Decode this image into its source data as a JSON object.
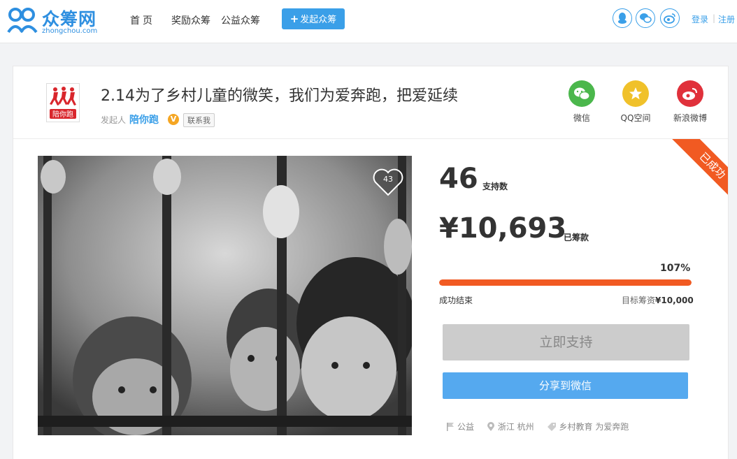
{
  "nav": {
    "logo_text": "众筹网",
    "logo_sub": "zhongchou.com",
    "home": "首页",
    "reward": "奖励众筹",
    "charity": "公益众筹",
    "launch": "发起众筹",
    "login": "登录",
    "separator": "|",
    "register": "注册",
    "icons": [
      "qq-icon",
      "wechat-icon",
      "weibo-icon"
    ]
  },
  "project": {
    "title": "2.14为了乡村儿童的微笑，我们为爱奔跑，把爱延续",
    "initiator_label": "发起人",
    "initiator_name": "陪你跑",
    "verified_badge": "V",
    "contact": "联系我",
    "logo_text": "陪你跑"
  },
  "share": {
    "wechat": "微信",
    "qzone": "QQ空间",
    "weibo": "新浪微博"
  },
  "photo": {
    "likes": "43"
  },
  "stats": {
    "backers": "46",
    "backers_label": "支持数",
    "raised": "¥10,693",
    "raised_label": "已筹款",
    "percent": "107%",
    "progress_fraction": 1.0,
    "status": "成功结束",
    "target_label": "目标筹资",
    "target_value": "¥10,000"
  },
  "actions": {
    "support": "立即支持",
    "share_wechat": "分享到微信"
  },
  "tags": {
    "category": "公益",
    "location": "浙江 杭州",
    "keywords": "乡村教育 为爱奔跑"
  },
  "ribbon": "已成功",
  "colors": {
    "brand_blue": "#3a9fe8",
    "progress_orange": "#f15a22",
    "wechat_green": "#4bb74c",
    "qzone_yellow": "#f0c12a",
    "weibo_red": "#e0313b"
  }
}
